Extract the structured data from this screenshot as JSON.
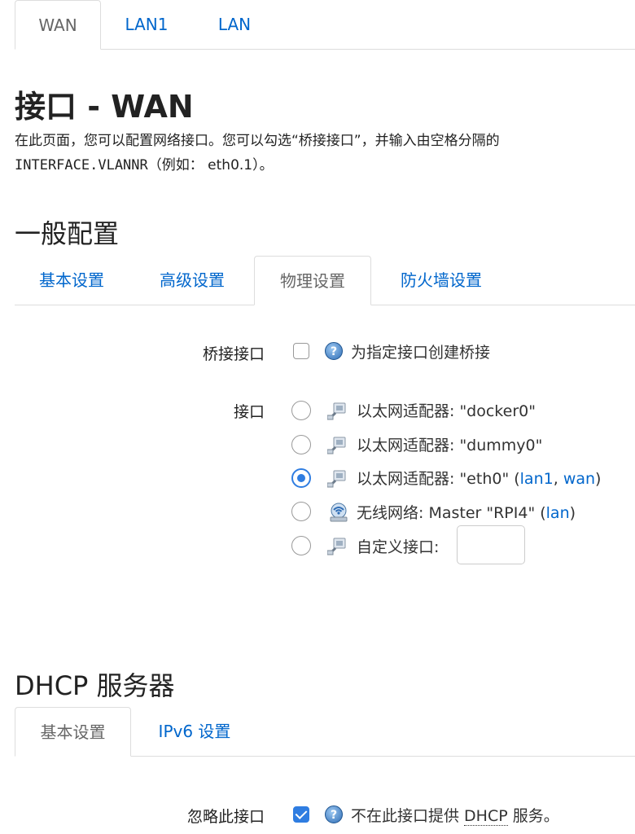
{
  "top_tabs": [
    {
      "label": "WAN",
      "active": true
    },
    {
      "label": "LAN1",
      "active": false
    },
    {
      "label": "LAN",
      "active": false
    }
  ],
  "page": {
    "title": "接口 - WAN",
    "description_line1": "在此页面，您可以配置网络接口。您可以勾选“桥接接口”，并输入由空格分隔的",
    "description_line2_mono": "INTERFACE.VLANNR",
    "description_line2_rest": "（例如： eth0.1）。"
  },
  "general": {
    "heading": "一般配置",
    "tabs": [
      {
        "label": "基本设置",
        "active": false
      },
      {
        "label": "高级设置",
        "active": false
      },
      {
        "label": "物理设置",
        "active": true
      },
      {
        "label": "防火墙设置",
        "active": false
      }
    ],
    "bridge": {
      "label": "桥接接口",
      "checked": false,
      "help_icon": "help-icon",
      "text": "为指定接口创建桥接"
    },
    "interface": {
      "label": "接口",
      "options": [
        {
          "icon": "ethernet-icon",
          "text": "以太网适配器: \"docker0\"",
          "checked": false
        },
        {
          "icon": "ethernet-icon",
          "text": "以太网适配器: \"dummy0\"",
          "checked": false
        },
        {
          "icon": "ethernet-icon",
          "text": "以太网适配器: \"eth0\" (",
          "checked": true,
          "links": [
            "lan1",
            "wan"
          ],
          "sep": ", ",
          "close": ")"
        },
        {
          "icon": "wifi-icon",
          "text": "无线网络: Master \"RPI4\" (",
          "checked": false,
          "links": [
            "lan"
          ],
          "close": ")"
        },
        {
          "icon": "ethernet-icon",
          "text": "自定义接口:",
          "checked": false,
          "input_value": ""
        }
      ]
    }
  },
  "dhcp": {
    "heading": "DHCP 服务器",
    "tabs": [
      {
        "label": "基本设置",
        "active": true
      },
      {
        "label": "IPv6 设置",
        "active": false
      }
    ],
    "ignore": {
      "label": "忽略此接口",
      "checked": true,
      "help_icon": "help-icon",
      "text_before": "不在此接口提供 ",
      "text_abbr": "DHCP",
      "text_after": " 服务。"
    }
  },
  "colors": {
    "link": "#0066cc",
    "accent": "#2f7de1"
  }
}
